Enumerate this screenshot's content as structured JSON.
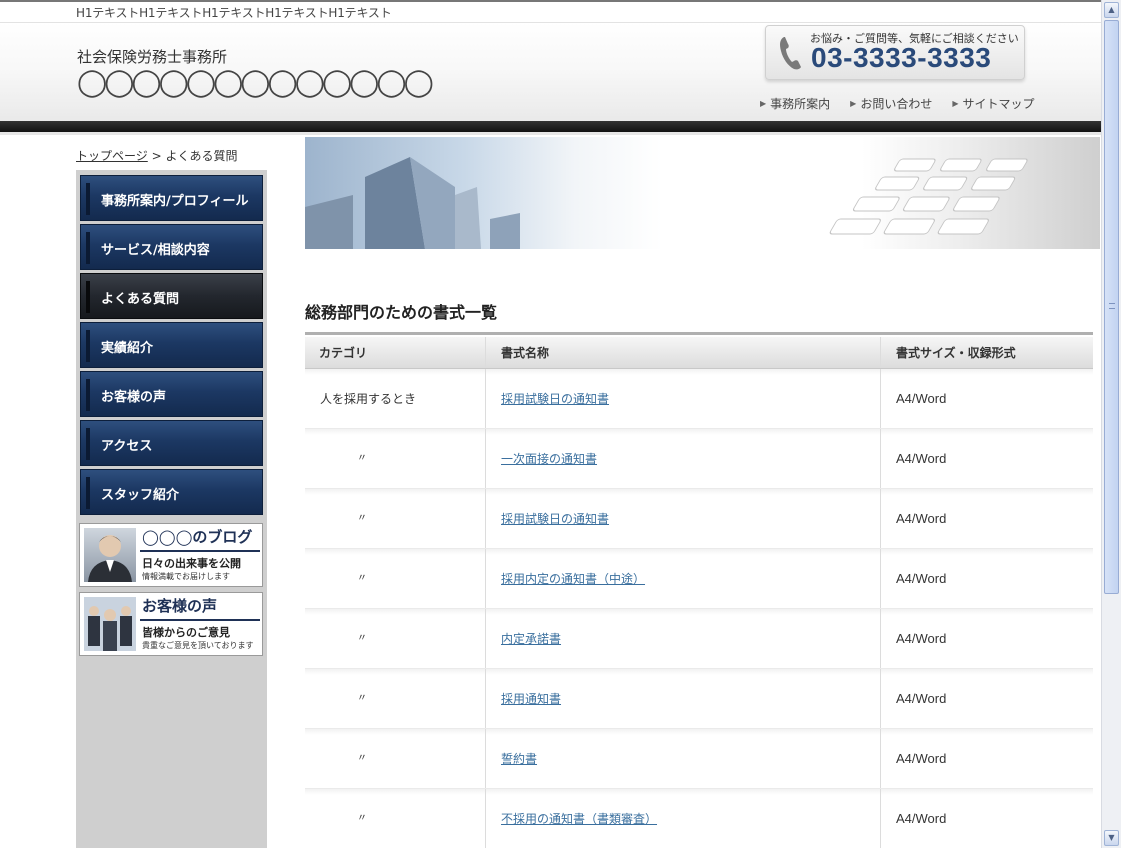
{
  "topbar": {
    "h1_text": "H1テキストH1テキストH1テキストH1テキストH1テキスト"
  },
  "header": {
    "office_type": "社会保険労務士事務所",
    "office_name": "◯◯◯◯◯◯◯◯◯◯◯◯◯",
    "phone_caption": "お悩み・ご質問等、気軽にご相談ください",
    "phone_number": "03-3333-3333",
    "nav": [
      {
        "label": "事務所案内",
        "icon": "triangle-right-icon"
      },
      {
        "label": "お問い合わせ",
        "icon": "triangle-right-icon"
      },
      {
        "label": "サイトマップ",
        "icon": "triangle-right-icon"
      }
    ]
  },
  "breadcrumb": {
    "home": "トップページ",
    "separator": " > ",
    "current": "よくある質問"
  },
  "sidebar": {
    "menu": [
      {
        "label": "事務所案内/プロフィール",
        "active": false
      },
      {
        "label": "サービス/相談内容",
        "active": false
      },
      {
        "label": "よくある質問",
        "active": true
      },
      {
        "label": "実績紹介",
        "active": false
      },
      {
        "label": "お客様の声",
        "active": false
      },
      {
        "label": "アクセス",
        "active": false
      },
      {
        "label": "スタッフ紹介",
        "active": false
      }
    ],
    "banners": [
      {
        "title": "◯◯◯のブログ",
        "subtitle": "日々の出来事を公開",
        "note": "情報満載でお届けします"
      },
      {
        "title": "お客様の声",
        "subtitle": "皆様からのご意見",
        "note": "貴重なご意見を頂いております"
      }
    ]
  },
  "main": {
    "section_title": "総務部門のための書式一覧",
    "columns": [
      "カテゴリ",
      "書式名称",
      "書式サイズ・収録形式"
    ],
    "rows": [
      {
        "category": "人を採用するとき",
        "doc": "採用試験日の通知書",
        "format": "A4/Word"
      },
      {
        "category": "〃",
        "doc": "一次面接の通知書",
        "format": "A4/Word"
      },
      {
        "category": "〃",
        "doc": "採用試験日の通知書",
        "format": "A4/Word"
      },
      {
        "category": "〃",
        "doc": "採用内定の通知書（中途）",
        "format": "A4/Word"
      },
      {
        "category": "〃",
        "doc": "内定承諾書",
        "format": "A4/Word"
      },
      {
        "category": "〃",
        "doc": "採用通知書",
        "format": "A4/Word"
      },
      {
        "category": "〃",
        "doc": "誓約書",
        "format": "A4/Word"
      },
      {
        "category": "〃",
        "doc": "不採用の通知書（書類審査）",
        "format": "A4/Word"
      }
    ]
  },
  "colors": {
    "nav_blue": "#1c3863",
    "nav_active": "#23272e",
    "link": "#3a6f9e",
    "phone": "#2a4a7a"
  }
}
